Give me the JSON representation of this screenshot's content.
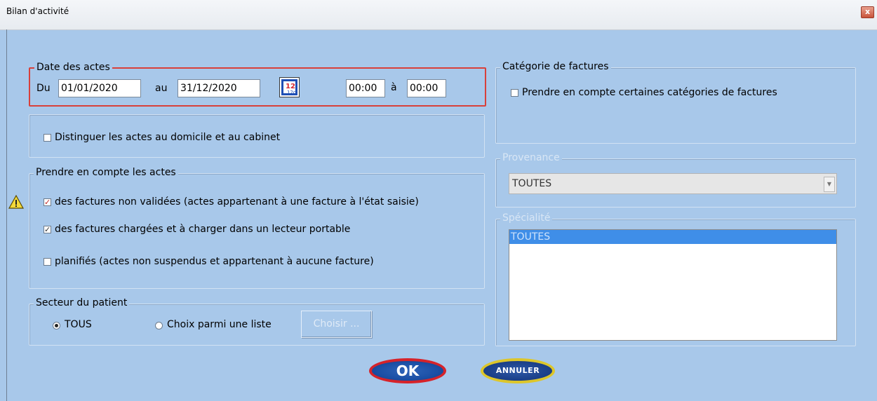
{
  "window": {
    "title": "Bilan d'activité",
    "close_glyph": "x"
  },
  "date_group": {
    "legend": "Date des actes",
    "du_label": "Du",
    "du_value": "01/01/2020",
    "au_label": "au",
    "au_value": "31/12/2020",
    "calendar_icon": "calendar-icon",
    "calendar_day": "12",
    "calendar_sub": "12c",
    "time_from": "00:00",
    "time_sep": "à",
    "time_to": "00:00"
  },
  "distinguish": {
    "label": "Distinguer les actes au domicile et au cabinet",
    "checked": false
  },
  "acts_group": {
    "legend": "Prendre en compte les actes",
    "items": [
      {
        "label": "des factures non validées (actes appartenant à une facture à l'état saisie)",
        "checked": true
      },
      {
        "label": "des factures chargées et à charger dans un lecteur portable",
        "checked": true
      },
      {
        "label": "planifiés (actes non suspendus et appartenant à aucune facture)",
        "checked": false
      }
    ],
    "warning_icon": "warning-icon"
  },
  "secteur_group": {
    "legend": "Secteur du patient",
    "option_all": "TOUS",
    "option_list": "Choix parmi une liste",
    "selected": "TOUS",
    "choose_button": "Choisir ..."
  },
  "categorie_group": {
    "legend": "Catégorie de factures",
    "checkbox_label": "Prendre en compte certaines catégories de factures",
    "checked": false
  },
  "provenance_group": {
    "legend": "Provenance",
    "selected_value": "TOUTES"
  },
  "specialite_group": {
    "legend": "Spécialité",
    "items": [
      "TOUTES"
    ]
  },
  "buttons": {
    "ok": "OK",
    "cancel": "ANNULER"
  },
  "colors": {
    "background": "#a8c8ea",
    "ok_border": "#d6232a",
    "cancel_border": "#ddc62a",
    "check_mark": "#c02b2b"
  }
}
